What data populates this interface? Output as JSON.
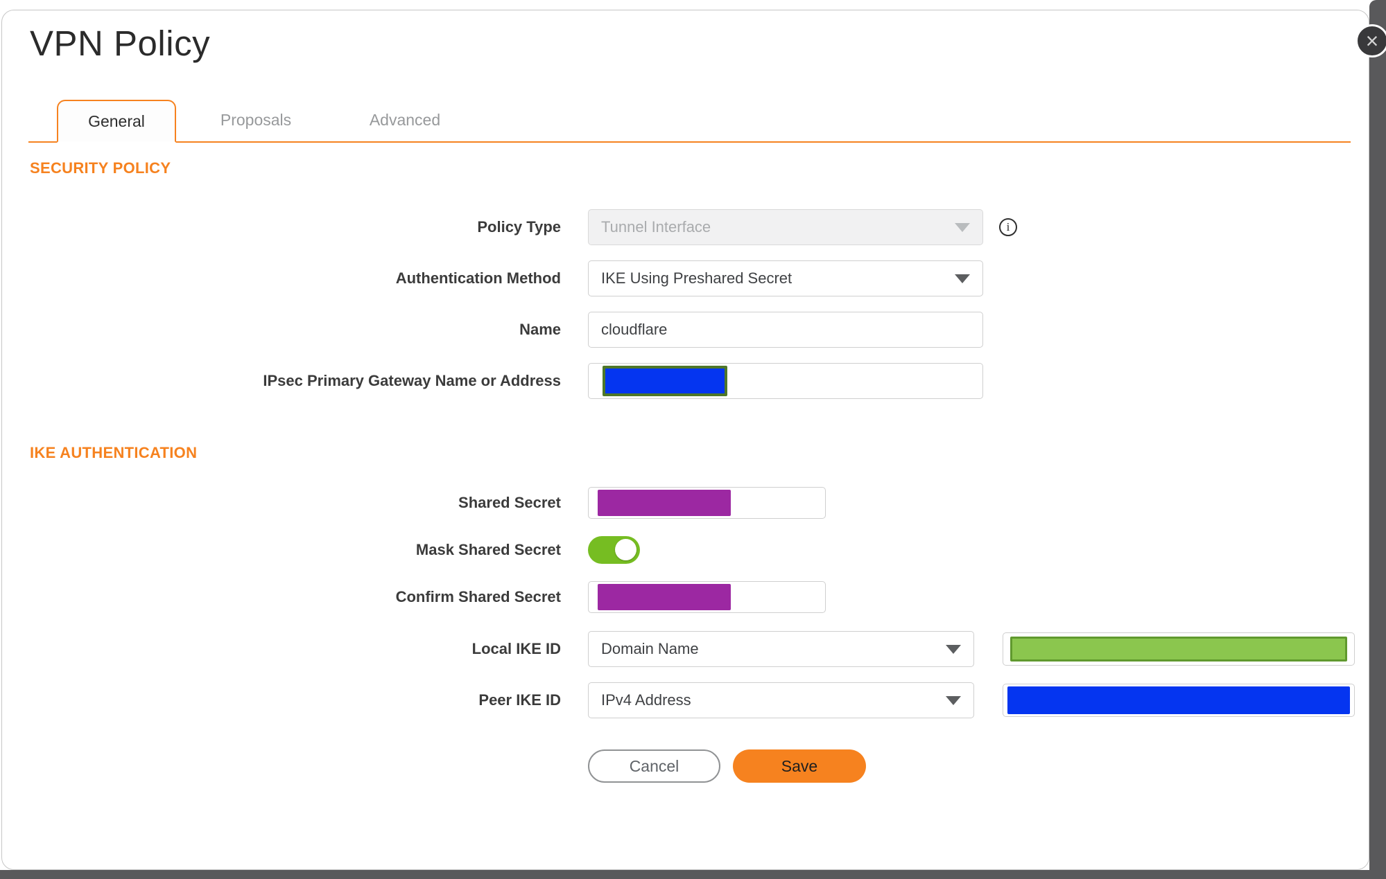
{
  "window": {
    "title": "VPN Policy"
  },
  "icons": {
    "close": "×",
    "info": "i",
    "dropdown_arrow": "filled-triangle-down"
  },
  "tabs": [
    {
      "label": "General",
      "active": true
    },
    {
      "label": "Proposals",
      "active": false
    },
    {
      "label": "Advanced",
      "active": false
    }
  ],
  "security_policy": {
    "heading": "SECURITY POLICY",
    "policy_type": {
      "label": "Policy Type",
      "value": "Tunnel Interface",
      "disabled": true
    },
    "authentication_method": {
      "label": "Authentication Method",
      "value": "IKE Using Preshared Secret"
    },
    "name": {
      "label": "Name",
      "value": "cloudflare"
    },
    "gateway": {
      "label": "IPsec Primary Gateway Name or Address",
      "value_redacted": "blue-block"
    }
  },
  "ike_authentication": {
    "heading": "IKE AUTHENTICATION",
    "shared_secret": {
      "label": "Shared Secret",
      "value_redacted": "purple-block"
    },
    "mask_shared_secret": {
      "label": "Mask Shared Secret",
      "state": "on"
    },
    "confirm_shared_secret": {
      "label": "Confirm Shared Secret",
      "value_redacted": "purple-block"
    },
    "local_ike_id": {
      "label": "Local IKE ID",
      "value": "Domain Name",
      "id_value_redacted": "green-block"
    },
    "peer_ike_id": {
      "label": "Peer IKE ID",
      "value": "IPv4 Address",
      "id_value_redacted": "blue-block"
    }
  },
  "footer": {
    "cancel_label": "Cancel",
    "save_label": "Save"
  },
  "colors": {
    "accent_orange": "#f6821f",
    "toggle_green": "#76bd22",
    "redaction_purple": "#9c28a2",
    "redaction_blue": "#0535f0",
    "green_fill": "#8bc64e",
    "green_border": "#60992e",
    "olive_border": "#4e7729",
    "backdrop_gray": "#59595b",
    "close_bg": "#39393b"
  }
}
